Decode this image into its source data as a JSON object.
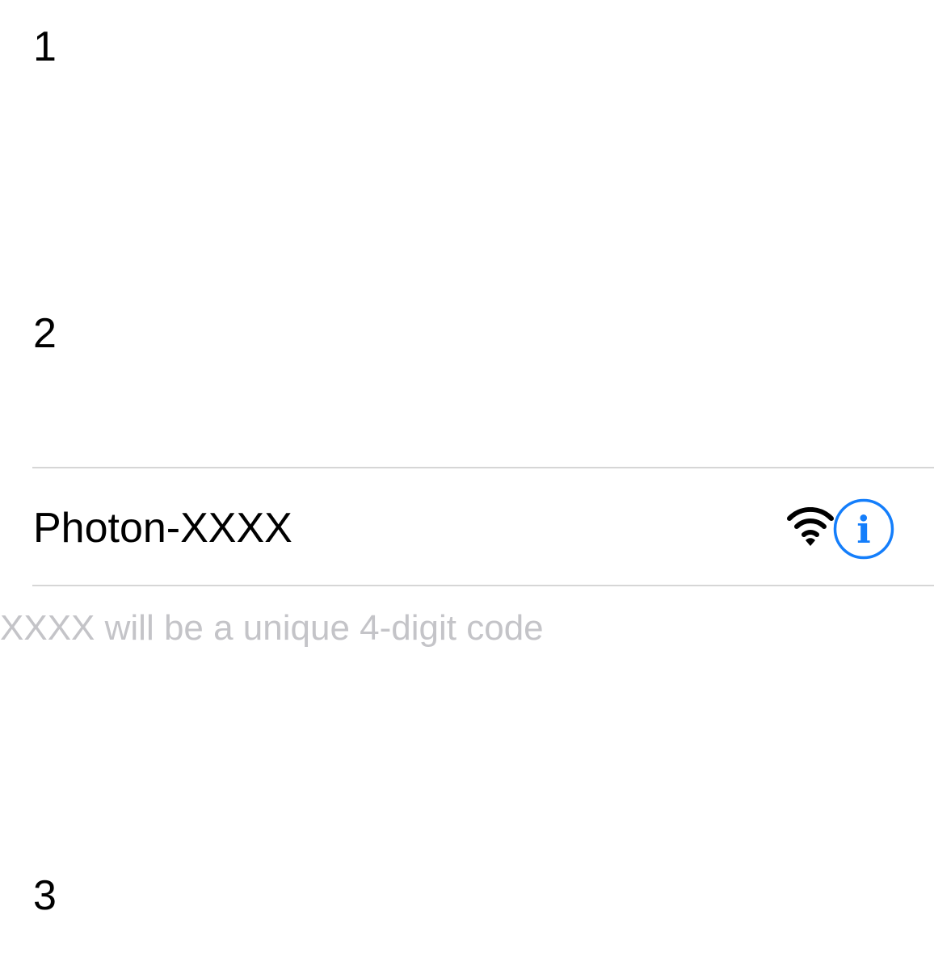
{
  "steps": {
    "one": "1",
    "two": "2",
    "three": "3"
  },
  "network": {
    "name": "Photon-XXXX",
    "signal_icon": "wifi-icon",
    "info_icon": "info-icon",
    "info_glyph": "i",
    "accent_color": "#147EFB"
  },
  "hint": {
    "text": "XXXX will be a unique 4-digit code"
  }
}
